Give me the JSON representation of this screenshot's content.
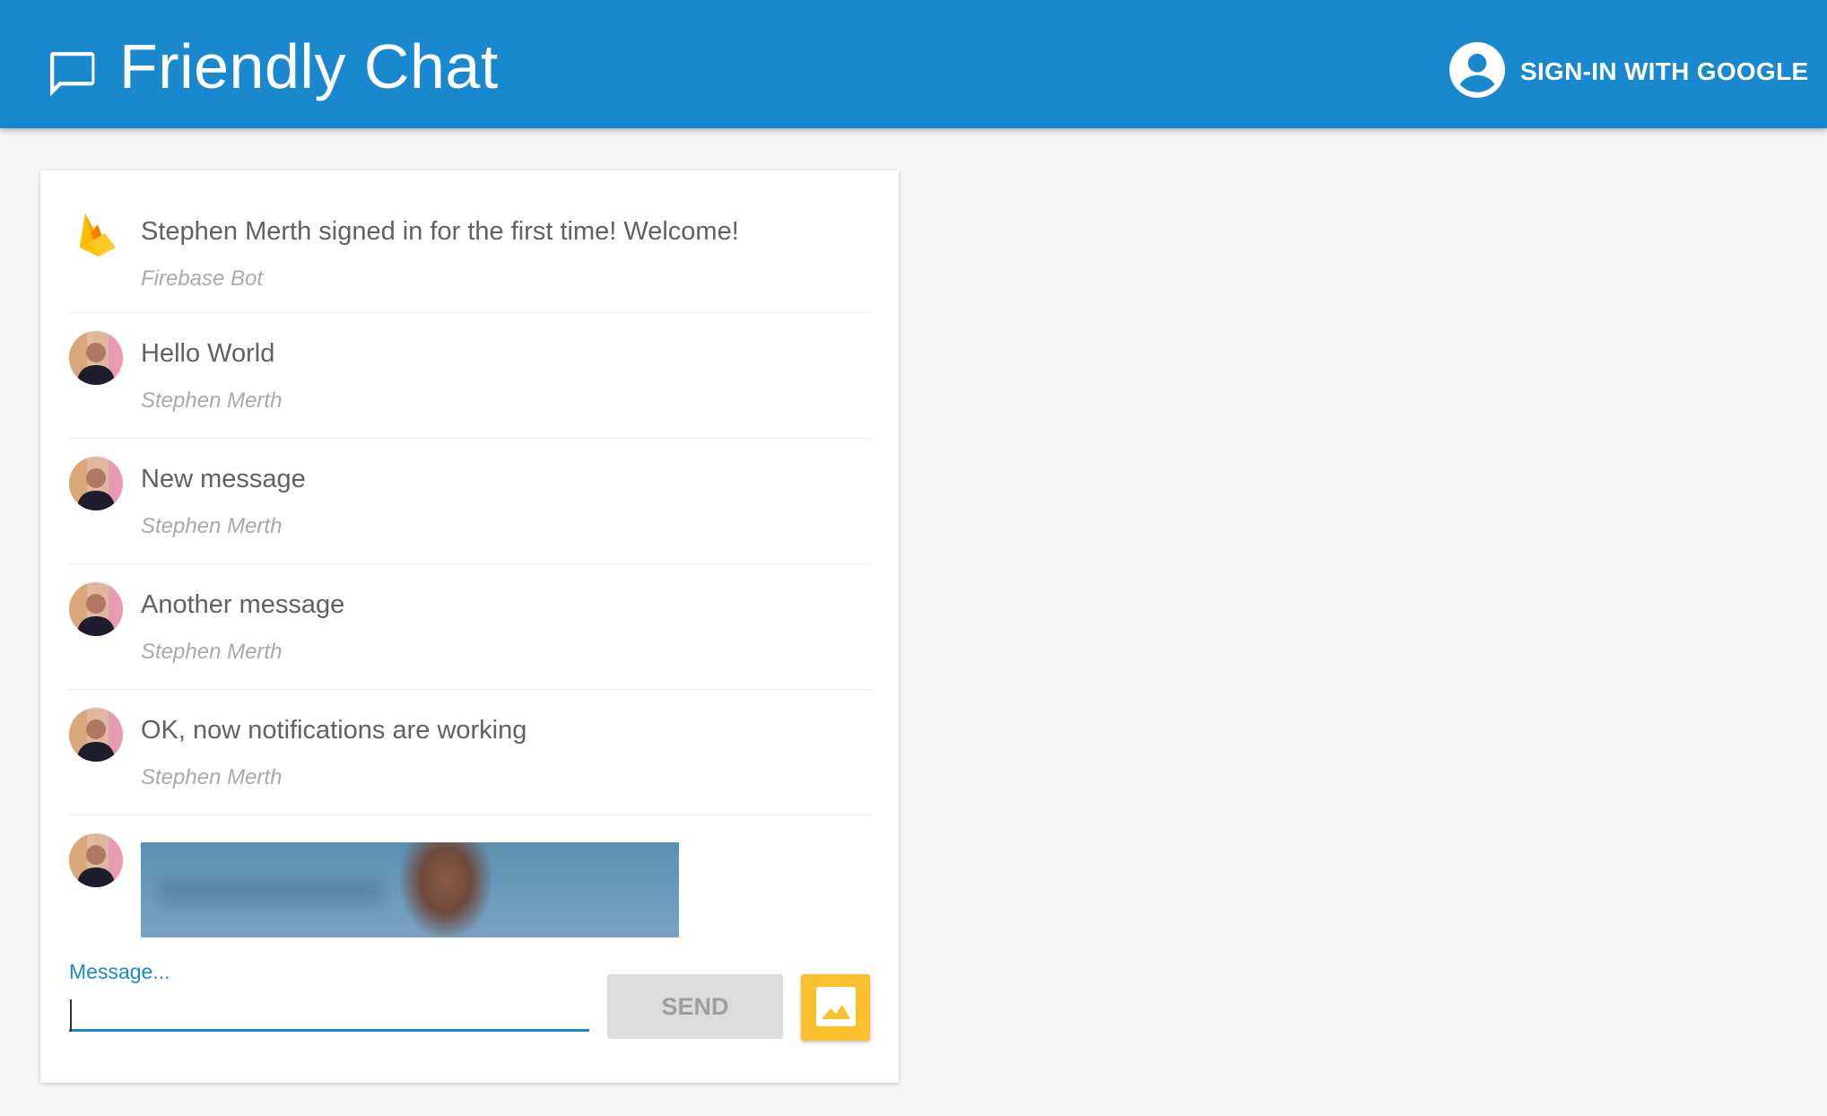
{
  "app": {
    "title": "Friendly Chat",
    "icon": "chat-bubble-icon",
    "signin_label": "SIGN-IN WITH GOOGLE",
    "signin_icon": "account-circle-icon"
  },
  "colors": {
    "header": "#1a88cf",
    "accent": "#1a88cf",
    "image_button": "#fbc02d",
    "send_disabled": "#dcdcdc"
  },
  "messages": [
    {
      "text": "Stephen Merth signed in for the first time! Welcome!",
      "author": "Firebase Bot",
      "avatar": "firebase-logo-icon"
    },
    {
      "text": "Hello World",
      "author": "Stephen Merth",
      "avatar": "user-photo"
    },
    {
      "text": "New message",
      "author": "Stephen Merth",
      "avatar": "user-photo"
    },
    {
      "text": "Another message",
      "author": "Stephen Merth",
      "avatar": "user-photo"
    },
    {
      "text": "OK, now notifications are working",
      "author": "Stephen Merth",
      "avatar": "user-photo"
    },
    {
      "text": "",
      "author": "",
      "avatar": "user-photo",
      "type": "image"
    }
  ],
  "composer": {
    "label": "Message...",
    "value": "",
    "send_label": "SEND",
    "image_icon": "image-icon"
  }
}
